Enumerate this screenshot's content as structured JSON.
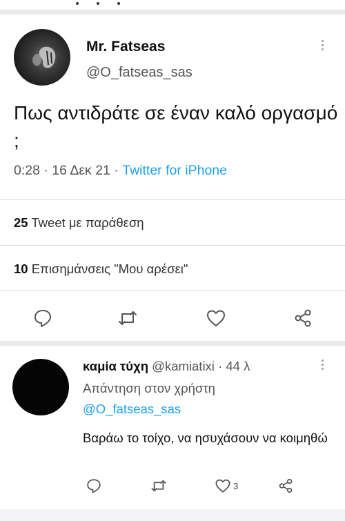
{
  "main_tweet": {
    "author": {
      "display_name": "Mr. Fatseas",
      "handle": "@O_fatseas_sas",
      "avatar_icon": "avatar-photo"
    },
    "text": "Πως αντιδράτε σε έναν καλό οργασμό ;",
    "time": "0:28",
    "date": "16 Δεκ 21",
    "source": "Twitter for iPhone",
    "quote_count": "25",
    "quote_label": "Tweet με παράθεση",
    "likes_count": "10",
    "likes_label": "Επισημάνσεις \"Μου αρέσει\"",
    "actions": [
      "reply-icon",
      "retweet-icon",
      "like-icon",
      "share-icon"
    ]
  },
  "reply": {
    "author": {
      "display_name": "καμία τύχη",
      "handle": "@kamiatixi",
      "age": "44 λ"
    },
    "reply_to_prefix": "Απάντηση στον χρήστη",
    "reply_to_handle": "@O_fatseas_sas",
    "text": "Βαράω  το τοίχο, να ησυχάσουν να κοιμηθώ",
    "like_count": "3",
    "actions": [
      "reply-icon",
      "retweet-icon",
      "like-icon",
      "share-icon"
    ]
  },
  "colors": {
    "accent": "#1da1f2",
    "separator": "#e9e9ec",
    "secondary_text": "#555555"
  }
}
